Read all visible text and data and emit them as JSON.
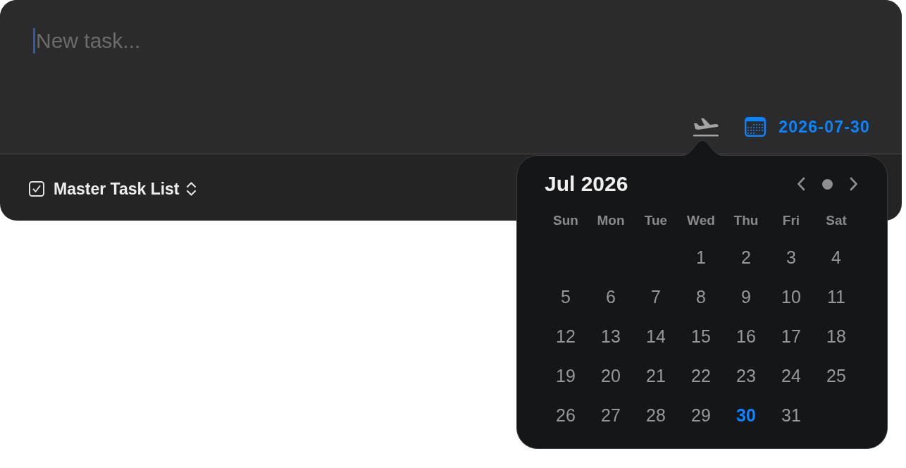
{
  "task_input": {
    "placeholder": "New task...",
    "focused": true
  },
  "toolbar": {
    "date": "2026-07-30"
  },
  "footer": {
    "list_name": "Master Task List"
  },
  "date_picker": {
    "title": "Jul 2026",
    "weekdays": [
      "Sun",
      "Mon",
      "Tue",
      "Wed",
      "Thu",
      "Fri",
      "Sat"
    ],
    "weeks": [
      [
        {
          "label": "1",
          "selected": false
        },
        {
          "label": "2",
          "selected": false
        },
        {
          "label": "3",
          "selected": false
        },
        {
          "label": "4",
          "selected": false
        }
      ],
      [
        {
          "label": "5",
          "selected": false
        },
        {
          "label": "6",
          "selected": false
        },
        {
          "label": "7",
          "selected": false
        },
        {
          "label": "8",
          "selected": false
        },
        {
          "label": "9",
          "selected": false
        },
        {
          "label": "10",
          "selected": false
        },
        {
          "label": "11",
          "selected": false
        }
      ],
      [
        {
          "label": "12",
          "selected": false
        },
        {
          "label": "13",
          "selected": false
        },
        {
          "label": "14",
          "selected": false
        },
        {
          "label": "15",
          "selected": false
        },
        {
          "label": "16",
          "selected": false
        },
        {
          "label": "17",
          "selected": false
        },
        {
          "label": "18",
          "selected": false
        }
      ],
      [
        {
          "label": "19",
          "selected": false
        },
        {
          "label": "20",
          "selected": false
        },
        {
          "label": "21",
          "selected": false
        },
        {
          "label": "22",
          "selected": false
        },
        {
          "label": "23",
          "selected": false
        },
        {
          "label": "24",
          "selected": false
        },
        {
          "label": "25",
          "selected": false
        }
      ],
      [
        {
          "label": "26",
          "selected": false
        },
        {
          "label": "27",
          "selected": false
        },
        {
          "label": "28",
          "selected": false
        },
        {
          "label": "29",
          "selected": false
        },
        {
          "label": "30",
          "selected": true
        },
        {
          "label": "31",
          "selected": false
        }
      ]
    ]
  }
}
